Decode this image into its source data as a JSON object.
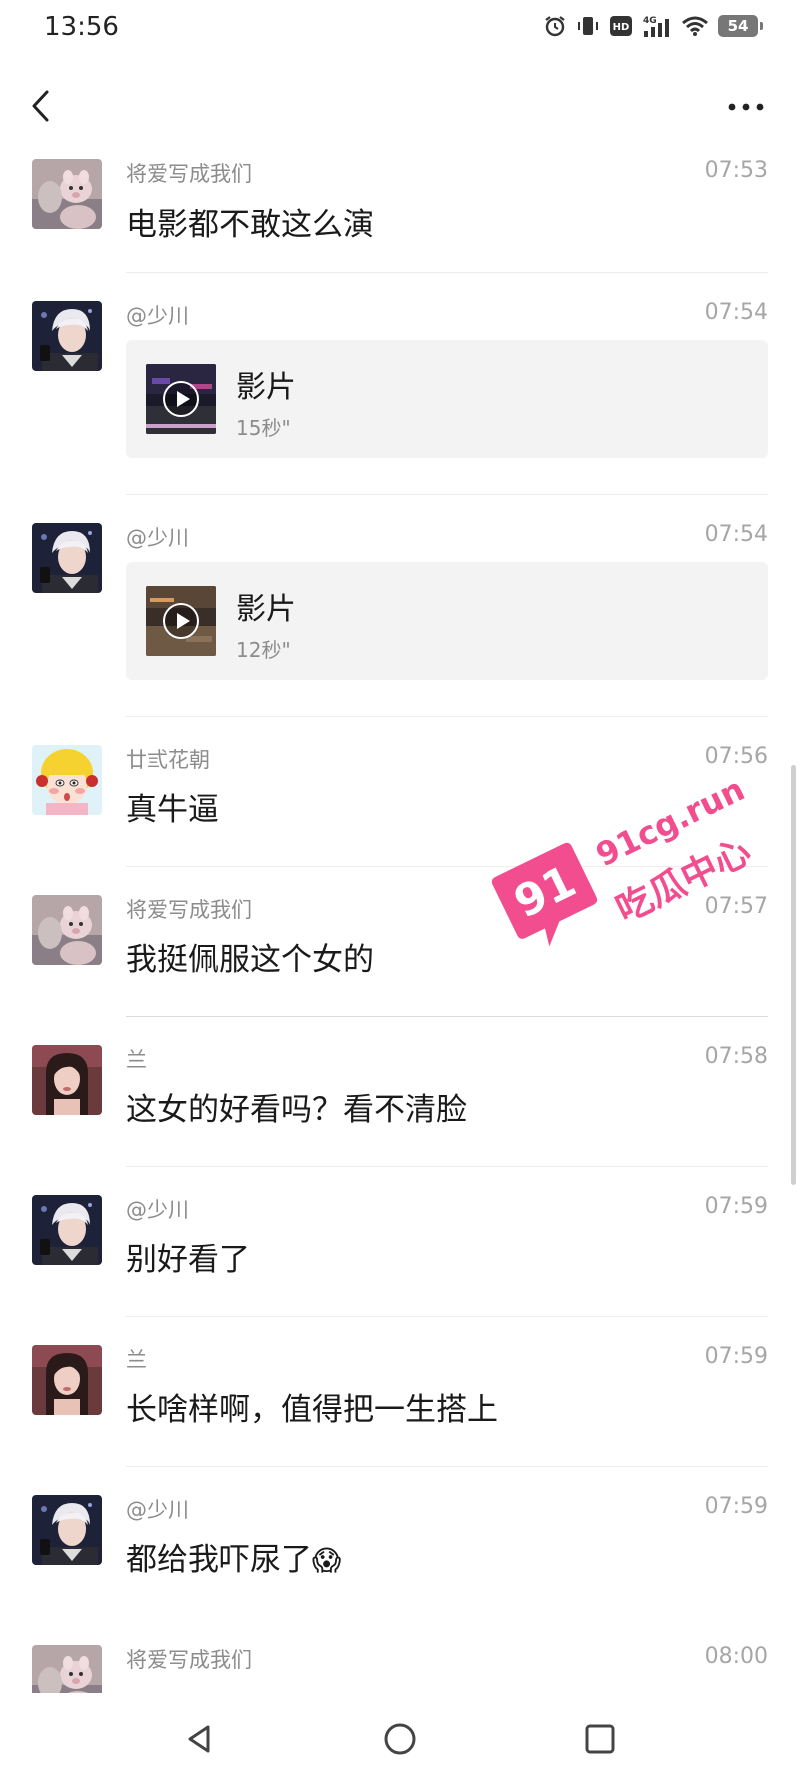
{
  "status_bar": {
    "time": "13:56",
    "network": "4G",
    "hd_badge": "HD",
    "battery": "54",
    "icons": [
      "alarm-icon",
      "vibrate-icon",
      "hd-icon",
      "signal-4g-icon",
      "wifi-icon",
      "battery-icon"
    ]
  },
  "nav": {
    "back_icon": "chevron-left-icon",
    "more_icon": "more-horizontal-icon"
  },
  "messages": [
    {
      "sender": "将爱写成我们",
      "time": "07:53",
      "text": "电影都不敢这么演",
      "avatar": "avatar-plush-toy"
    },
    {
      "sender": "@少川",
      "time": "07:54",
      "type": "video",
      "video_title": "影片",
      "video_duration": "15秒\"",
      "avatar": "avatar-white-hair"
    },
    {
      "sender": "@少川",
      "time": "07:54",
      "type": "video",
      "video_title": "影片",
      "video_duration": "12秒\"",
      "avatar": "avatar-white-hair"
    },
    {
      "sender": "廿弎花朝",
      "time": "07:56",
      "text": "真牛逼",
      "avatar": "avatar-cartoon-girl"
    },
    {
      "sender": "将爱写成我们",
      "time": "07:57",
      "text": "我挺佩服这个女的",
      "avatar": "avatar-plush-toy"
    },
    {
      "sender": "兰",
      "time": "07:58",
      "text": "这女的好看吗？看不清脸",
      "avatar": "avatar-woman-photo"
    },
    {
      "sender": "@少川",
      "time": "07:59",
      "text": "别好看了",
      "avatar": "avatar-white-hair"
    },
    {
      "sender": "兰",
      "time": "07:59",
      "text": "长啥样啊，值得把一生搭上",
      "avatar": "avatar-woman-photo"
    },
    {
      "sender": "@少川",
      "time": "07:59",
      "text": "都给我吓尿了",
      "emoji": "😱",
      "avatar": "avatar-white-hair"
    },
    {
      "sender": "将爱写成我们",
      "time": "08:00",
      "text": "",
      "avatar": "avatar-plush-toy"
    }
  ],
  "watermark": {
    "badge": "91",
    "domain": "91cg.run",
    "name": "吃瓜中心"
  },
  "bottom_nav": {
    "back": "triangle-back-icon",
    "home": "circle-home-icon",
    "recents": "square-recents-icon"
  }
}
